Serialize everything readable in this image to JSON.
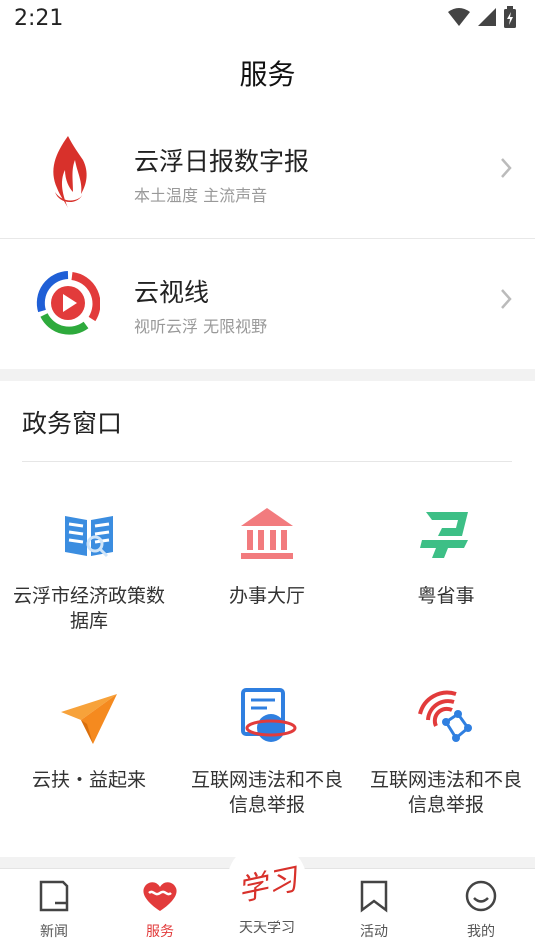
{
  "status_bar": {
    "time": "2:21"
  },
  "header": {
    "title": "服务"
  },
  "services": [
    {
      "name": "云浮日报数字报",
      "desc": "本土温度  主流声音"
    },
    {
      "name": "云视线",
      "desc": "视听云浮  无限视野"
    }
  ],
  "gov": {
    "title": "政务窗口",
    "items": [
      {
        "label": "云浮市经济政策数据库",
        "icon": "book-icon"
      },
      {
        "label": "办事大厅",
        "icon": "bank-icon"
      },
      {
        "label": "粤省事",
        "icon": "yue-app-icon"
      },
      {
        "label": "云扶・益起来",
        "icon": "paper-plane-icon"
      },
      {
        "label": "互联网违法和不良信息举报",
        "icon": "report-globe-icon"
      },
      {
        "label": "互联网违法和不良信息举报",
        "icon": "signal-network-icon"
      }
    ]
  },
  "tabbar": {
    "tabs": [
      {
        "label": "新闻"
      },
      {
        "label": "服务"
      },
      {
        "label": "天天学习"
      },
      {
        "label": "活动"
      },
      {
        "label": "我的"
      }
    ],
    "active": "服务",
    "center_badge_text": "学习"
  },
  "colors": {
    "accent": "#e23b3b",
    "muted": "#999999"
  }
}
